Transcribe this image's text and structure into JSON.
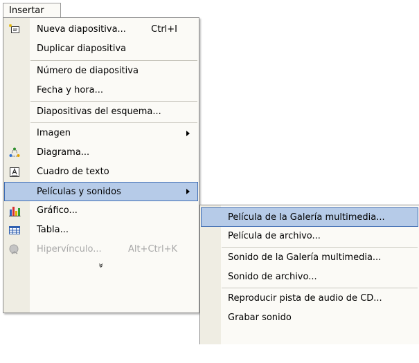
{
  "menubar": {
    "title": "Insertar"
  },
  "menu": {
    "new_slide": {
      "label": "Nueva diapositiva...",
      "shortcut": "Ctrl+I"
    },
    "duplicate_slide": {
      "label": "Duplicar diapositiva"
    },
    "slide_number": {
      "label": "Número de diapositiva"
    },
    "date_time": {
      "label": "Fecha y hora..."
    },
    "outline_slides": {
      "label": "Diapositivas del esquema..."
    },
    "image": {
      "label": "Imagen"
    },
    "diagram": {
      "label": "Diagrama..."
    },
    "text_box": {
      "label": "Cuadro de texto"
    },
    "movies_sounds": {
      "label": "Películas y sonidos"
    },
    "chart": {
      "label": "Gráfico..."
    },
    "table": {
      "label": "Tabla..."
    },
    "hyperlink": {
      "label": "Hipervínculo...",
      "shortcut": "Alt+Ctrl+K"
    },
    "expand": {
      "label": "»"
    }
  },
  "submenu": {
    "gallery_movie": {
      "label": "Película de la Galería multimedia..."
    },
    "file_movie": {
      "label": "Película de archivo..."
    },
    "gallery_sound": {
      "label": "Sonido de la Galería multimedia..."
    },
    "file_sound": {
      "label": "Sonido de archivo..."
    },
    "cd_audio": {
      "label": "Reproducir pista de audio de CD..."
    },
    "record_sound": {
      "label": "Grabar sonido"
    }
  },
  "colors": {
    "highlight": "#b6cbe8",
    "highlight_border": "#3f6db3",
    "gutter": "#efede3",
    "menu_bg": "#fbfaf6"
  }
}
